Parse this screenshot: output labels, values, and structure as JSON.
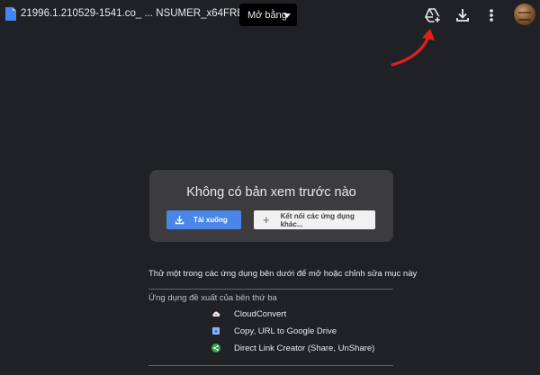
{
  "header": {
    "filename": "21996.1.210529-1541.co_ ... NSUMER_x64FRE_en-us.iso",
    "open_with_label": "Mở bằng",
    "icons": {
      "file": "file-icon",
      "add_to_drive": "add-to-drive-icon",
      "download": "download-icon",
      "more": "more-vert-icon",
      "avatar": "avatar"
    }
  },
  "preview": {
    "title": "Không có bản xem trước nào",
    "download_label": "Tải xuống",
    "connect_label": "Kết nối các ứng dụng khác..."
  },
  "apps": {
    "hint": "Thử một trong các ứng dụng bên dưới để mở hoặc chỉnh sửa mục này",
    "section_label": "Ứng dụng đề xuất của bên thứ ba",
    "items": [
      {
        "name": "CloudConvert",
        "icon": "cloudconvert-icon"
      },
      {
        "name": "Copy, URL to Google Drive",
        "icon": "copy-url-icon"
      },
      {
        "name": "Direct Link Creator (Share, UnShare)",
        "icon": "share-icon"
      }
    ]
  },
  "colors": {
    "background": "#202124",
    "card": "#3c3c3f",
    "primary_button": "#4a86e8",
    "annotation_arrow": "#e02020"
  }
}
